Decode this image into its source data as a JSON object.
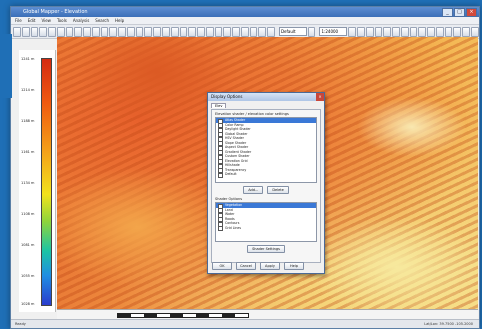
{
  "window": {
    "title": "Global Mapper - Elevation"
  },
  "menu": [
    "File",
    "Edit",
    "View",
    "Tools",
    "Analysis",
    "Search",
    "Help"
  ],
  "toolbar": {
    "layer_combo": "Default",
    "zoom_combo": "1:24000"
  },
  "legend": {
    "ticks": [
      "1241 m",
      "1214 m",
      "1188 m",
      "1161 m",
      "1134 m",
      "1108 m",
      "1081 m",
      "1055 m",
      "1028 m"
    ]
  },
  "dialog": {
    "title": "Display Options",
    "tab": "Elev",
    "group1": "Elevation shader / elevation color settings",
    "list1": [
      "Atlas Shader",
      "Color Ramp",
      "Daylight Shader",
      "Global Shader",
      "HSV Shader",
      "Slope Shader",
      "Aspect Shader",
      "Gradient Shader",
      "Custom Shader",
      "Elevation Grid",
      "Hillshade",
      "Transparency",
      "Default"
    ],
    "btn_add": "Add...",
    "btn_delete": "Delete",
    "group2": "Shader Options",
    "list2": [
      "Vegetation",
      "Land",
      "Water",
      "Roads",
      "Contours",
      "Grid Lines"
    ],
    "btn_shader": "Shader Settings",
    "ok": "OK",
    "cancel": "Cancel",
    "apply": "Apply",
    "help": "Help"
  },
  "status": {
    "left": "Ready",
    "right": "Lat/Lon: 39.7500 -105.2000"
  }
}
